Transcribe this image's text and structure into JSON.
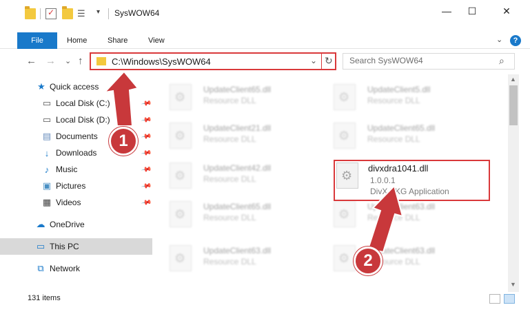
{
  "window": {
    "title": "SysWOW64",
    "minimize_glyph": "—",
    "maximize_glyph": "☐",
    "close_glyph": "✕"
  },
  "ribbon": {
    "tabs": [
      "File",
      "Home",
      "Share",
      "View"
    ],
    "expand_glyph": "⌄",
    "help_glyph": "?"
  },
  "navigation": {
    "back_glyph": "←",
    "forward_glyph": "→",
    "recent_glyph": "⌄",
    "up_glyph": "↑",
    "address": "C:\\Windows\\SysWOW64",
    "refresh_glyph": "↻",
    "search_placeholder": "Search SysWOW64"
  },
  "sidebar": {
    "items": [
      {
        "label": "Quick access",
        "icon": "star-icon"
      },
      {
        "label": "Local Disk (C:)",
        "icon": "drive-icon",
        "pinned": true
      },
      {
        "label": "Local Disk (D:)",
        "icon": "drive-icon",
        "pinned": true
      },
      {
        "label": "Documents",
        "icon": "documents-icon",
        "pinned": true
      },
      {
        "label": "Downloads",
        "icon": "download-icon",
        "pinned": true
      },
      {
        "label": "Music",
        "icon": "music-icon",
        "pinned": true
      },
      {
        "label": "Pictures",
        "icon": "pictures-icon",
        "pinned": true
      },
      {
        "label": "Videos",
        "icon": "videos-icon",
        "pinned": true
      },
      {
        "label": "OneDrive",
        "icon": "cloud-icon"
      },
      {
        "label": "This PC",
        "icon": "computer-icon",
        "selected": true
      },
      {
        "label": "Network",
        "icon": "network-icon"
      }
    ]
  },
  "files": [
    {
      "name": "UpdateClient65.dll",
      "desc": "Resource DLL"
    },
    {
      "name": "UpdateClient5.dll",
      "desc": "Resource DLL"
    },
    {
      "name": "UpdateClient21.dll",
      "desc": "Resource DLL"
    },
    {
      "name": "UpdateClient65.dll",
      "desc": "Resource DLL"
    },
    {
      "name": "UpdateClient42.dll",
      "desc": "Resource DLL"
    },
    {
      "name": "divxdra1041.dll",
      "version": "1.0.0.1",
      "desc": "DivX FKG Application"
    },
    {
      "name": "UpdateClient65.dll",
      "desc": "Resource DLL"
    },
    {
      "name": "UpdateClient63.dll",
      "desc": "Resource DLL"
    },
    {
      "name": "UpdateClient63.dll",
      "desc": "Resource DLL"
    },
    {
      "name": "UpdateClient63.dll",
      "desc": "Resource DLL"
    }
  ],
  "status": {
    "item_count": "131 items"
  },
  "annotations": {
    "step1": "1",
    "step2": "2",
    "color": "#c8383b"
  },
  "colors": {
    "accent": "#1979ca",
    "highlight_border": "#d9383a",
    "selection": "#d9d9d9"
  }
}
